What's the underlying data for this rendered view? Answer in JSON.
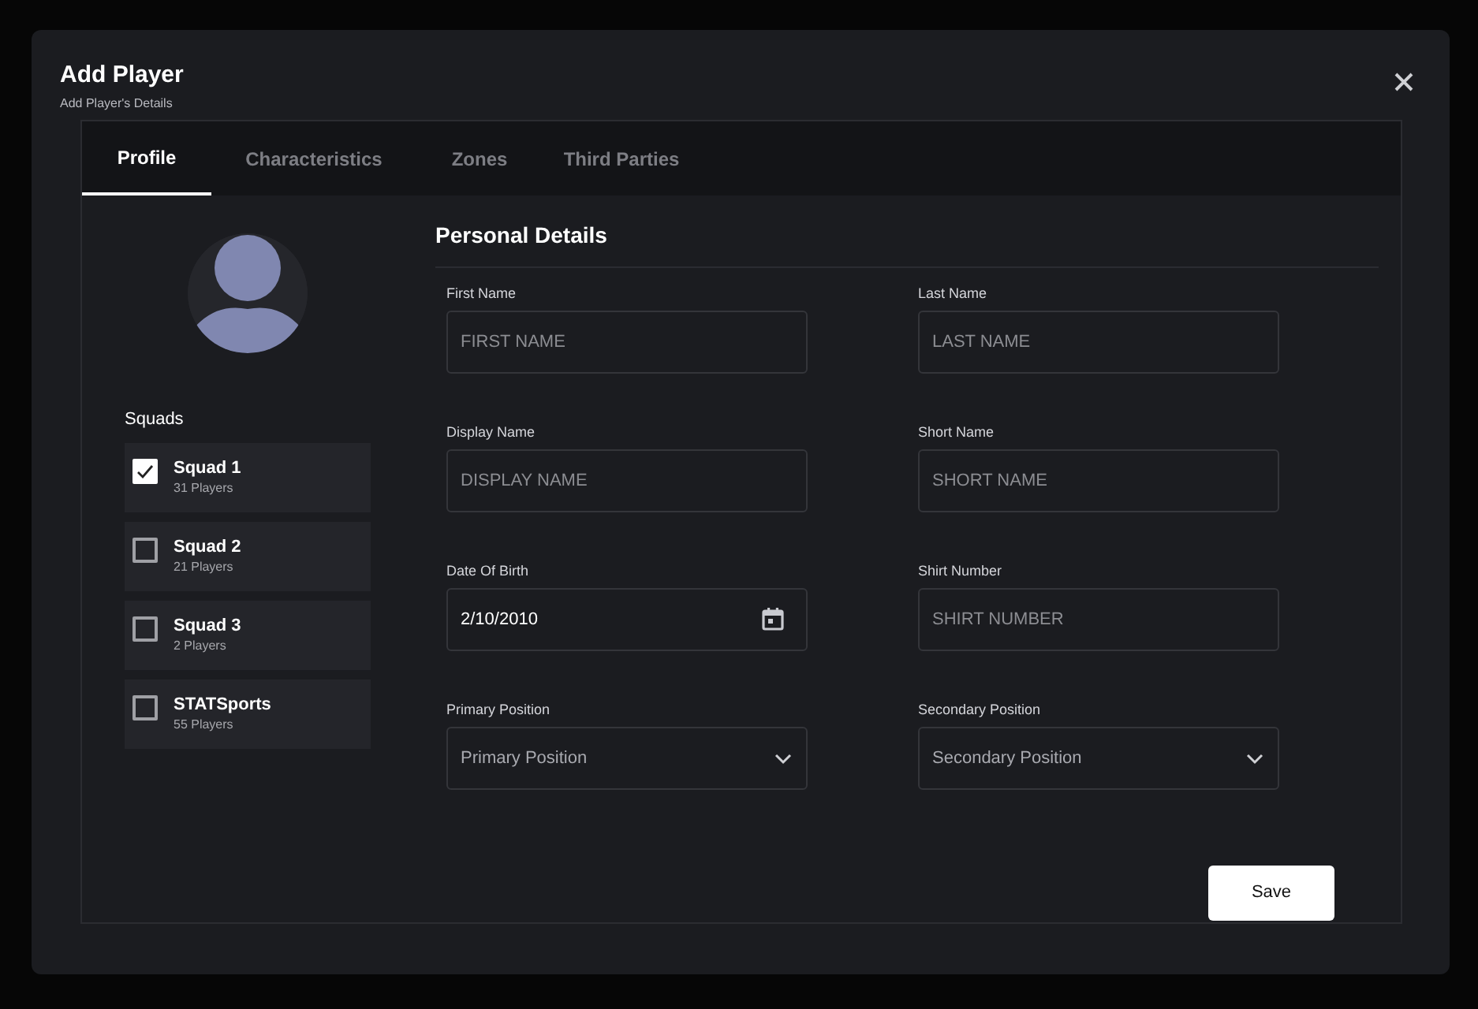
{
  "dialog": {
    "title": "Add Player",
    "subtitle": "Add Player's Details"
  },
  "tabs": [
    {
      "label": "Profile",
      "selected": true
    },
    {
      "label": "Characteristics",
      "selected": false
    },
    {
      "label": "Zones",
      "selected": false
    },
    {
      "label": "Third Parties",
      "selected": false
    }
  ],
  "squads_label": "Squads",
  "squads": [
    {
      "name": "Squad 1",
      "count": "31 Players",
      "checked": true
    },
    {
      "name": "Squad 2",
      "count": "21 Players",
      "checked": false
    },
    {
      "name": "Squad 3",
      "count": "2 Players",
      "checked": false
    },
    {
      "name": "STATSports",
      "count": "55 Players",
      "checked": false
    }
  ],
  "section_title": "Personal Details",
  "fields": [
    {
      "label": "First Name",
      "kind": "text",
      "placeholder": "FIRST NAME"
    },
    {
      "label": "Last Name",
      "kind": "text",
      "placeholder": "LAST NAME"
    },
    {
      "label": "Display Name",
      "kind": "text",
      "placeholder": "DISPLAY NAME"
    },
    {
      "label": "Short Name",
      "kind": "text",
      "placeholder": "SHORT NAME"
    },
    {
      "label": "Date Of Birth",
      "kind": "date",
      "value": "2/10/2010"
    },
    {
      "label": "Shirt Number",
      "kind": "text",
      "placeholder": "SHIRT NUMBER"
    },
    {
      "label": "Primary Position",
      "kind": "select",
      "placeholder": "Primary Position"
    },
    {
      "label": "Secondary Position",
      "kind": "select",
      "placeholder": "Secondary Position"
    }
  ],
  "save_button": "Save"
}
